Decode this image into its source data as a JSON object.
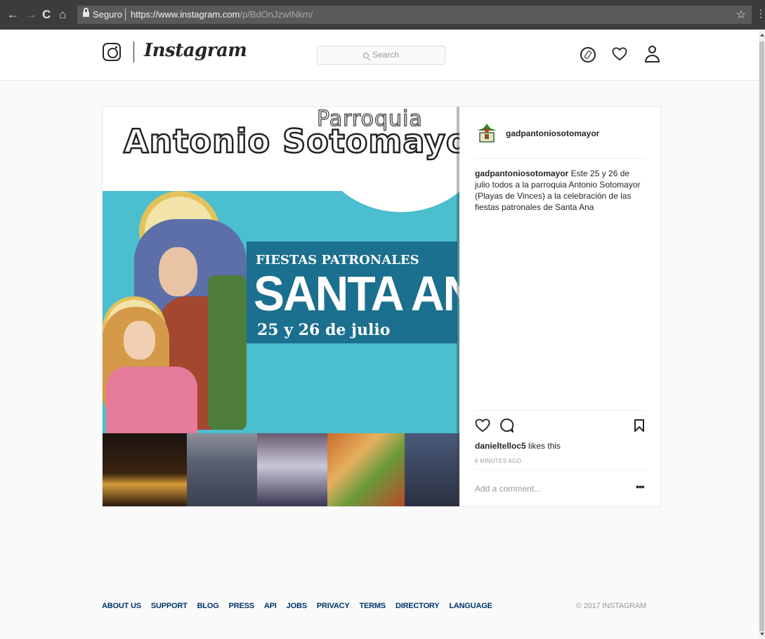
{
  "browser": {
    "secure_label": "Seguro",
    "url_host": "https://www.instagram.com",
    "url_path": "/p/BdOnJzwINkm/",
    "back": "←",
    "forward": "→",
    "reload": "C",
    "home": "⌂",
    "star": "☆",
    "menu": "⋮"
  },
  "header": {
    "wordmark": "Instagram",
    "search_placeholder": "Search"
  },
  "post": {
    "image_text": {
      "parroquia": "Parroquia",
      "title": "Antonio Sotomayor",
      "fiestas": "FIESTAS PATRONALES",
      "santa": "SANTA ANA",
      "fecha": "25 y 26 de julio"
    },
    "username": "gadpantoniosotomayor",
    "caption_user": "gadpantoniosotomayor",
    "caption_text": " Este 25 y 26 de julio todos a la parroquia Antonio Sotomayor (Playas de Vinces) a la celebración de las fiestas patronales de Santa Ana",
    "likes_user": "danieltelloc5",
    "likes_suffix": " likes this",
    "time": "6 MINUTES AGO",
    "comment_placeholder": "Add a comment...",
    "more": "•••"
  },
  "footer": {
    "links": [
      "ABOUT US",
      "SUPPORT",
      "BLOG",
      "PRESS",
      "API",
      "JOBS",
      "PRIVACY",
      "TERMS",
      "DIRECTORY",
      "LANGUAGE"
    ],
    "copyright": "© 2017 INSTAGRAM"
  },
  "colors": {
    "link": "#003569",
    "poster_teal": "#4bbecf",
    "poster_panel": "#1b6f8f"
  }
}
